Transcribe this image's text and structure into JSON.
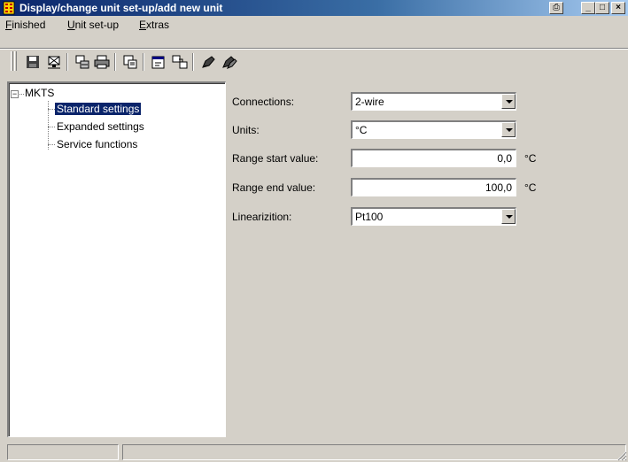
{
  "window": {
    "title": "Display/change unit set-up/add new unit",
    "buttons": {
      "print": "⎙",
      "minimize": "_",
      "maximize": "□",
      "close": "×"
    }
  },
  "menu": [
    {
      "mnemonic": "F",
      "rest": "inished"
    },
    {
      "mnemonic": "U",
      "rest": "nit set-up"
    },
    {
      "mnemonic": "E",
      "rest": "xtras"
    }
  ],
  "toolbar": {
    "icons": [
      "save-icon",
      "network-icon",
      "transfer-icon",
      "print-icon",
      "copy-icon",
      "properties-icon",
      "compare-icon",
      "pen-icon",
      "pen-double-icon"
    ]
  },
  "tree": {
    "root": "MKTS",
    "expander": "−",
    "items": [
      {
        "label": "Standard settings",
        "selected": true
      },
      {
        "label": "Expanded settings",
        "selected": false
      },
      {
        "label": "Service functions",
        "selected": false
      }
    ]
  },
  "form": {
    "connections": {
      "label": "Connections:",
      "value": "2-wire"
    },
    "units": {
      "label": "Units:",
      "value": "°C"
    },
    "range_start": {
      "label": "Range start value:",
      "value": "0,0",
      "unit": "°C"
    },
    "range_end": {
      "label": "Range end value:",
      "value": "100,0",
      "unit": "°C"
    },
    "linearization": {
      "label": "Linearizition:",
      "value": "Pt100"
    }
  },
  "colors": {
    "titlebar": "#0a246a",
    "selection": "#0a246a",
    "face": "#d4d0c8"
  }
}
